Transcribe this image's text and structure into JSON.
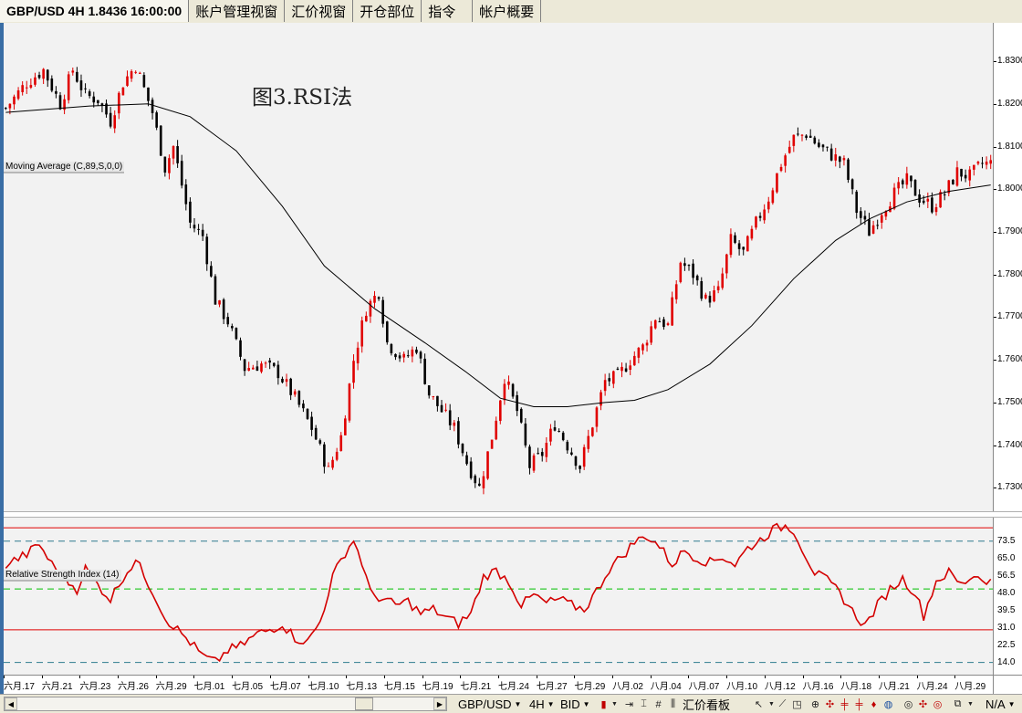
{
  "tabs": [
    {
      "label": "GBP/USD  4H  1.8436  16:00:00",
      "active": true
    },
    {
      "label": "账户管理视窗"
    },
    {
      "label": "汇价视窗"
    },
    {
      "label": "开仓部位"
    },
    {
      "label": "指令"
    },
    {
      "label": "帐户概要"
    }
  ],
  "annotation": "图3.RSI法",
  "indicators": {
    "moving_average": "Moving Average (C,89,S,0,0)",
    "rsi": "Relative Strength Index (14)"
  },
  "colors": {
    "bull": "#e00000",
    "bear": "#000000",
    "ma": "#000000",
    "rsi_line": "#d40000",
    "rsi_red_lines": "#e00000",
    "rsi_teal_lines": "#2e7b8e",
    "rsi_mid_line": "#00c000"
  },
  "chart_data": [
    {
      "type": "candlestick",
      "symbol": "GBP/USD",
      "timeframe": "4H",
      "last_price": "1.8436",
      "yticks": [
        "1.8300",
        "1.8200",
        "1.8100",
        "1.8000",
        "1.7900",
        "1.7800",
        "1.7700",
        "1.7600",
        "1.7500",
        "1.7400",
        "1.7300"
      ],
      "ylim": [
        1.7245,
        1.839
      ],
      "close_path": [
        [
          0,
          1.819
        ],
        [
          5,
          1.825
        ],
        [
          9,
          1.828
        ],
        [
          13,
          1.82
        ],
        [
          16,
          1.828
        ],
        [
          19,
          1.822
        ],
        [
          22,
          1.821
        ],
        [
          25,
          1.816
        ],
        [
          28,
          1.825
        ],
        [
          31,
          1.829
        ],
        [
          35,
          1.818
        ],
        [
          38,
          1.805
        ],
        [
          40,
          1.81
        ],
        [
          44,
          1.792
        ],
        [
          47,
          1.789
        ],
        [
          50,
          1.774
        ],
        [
          53,
          1.769
        ],
        [
          57,
          1.758
        ],
        [
          61,
          1.759
        ],
        [
          65,
          1.757
        ],
        [
          69,
          1.751
        ],
        [
          73,
          1.744
        ],
        [
          77,
          1.734
        ],
        [
          80,
          1.742
        ],
        [
          83,
          1.76
        ],
        [
          86,
          1.772
        ],
        [
          89,
          1.776
        ],
        [
          91,
          1.764
        ],
        [
          95,
          1.76
        ],
        [
          98,
          1.763
        ],
        [
          101,
          1.752
        ],
        [
          104,
          1.748
        ],
        [
          107,
          1.744
        ],
        [
          110,
          1.736
        ],
        [
          113,
          1.73
        ],
        [
          116,
          1.742
        ],
        [
          119,
          1.756
        ],
        [
          122,
          1.748
        ],
        [
          125,
          1.735
        ],
        [
          128,
          1.738
        ],
        [
          131,
          1.745
        ],
        [
          134,
          1.74
        ],
        [
          137,
          1.735
        ],
        [
          140,
          1.745
        ],
        [
          143,
          1.755
        ],
        [
          146,
          1.756
        ],
        [
          149,
          1.76
        ],
        [
          152,
          1.763
        ],
        [
          155,
          1.77
        ],
        [
          158,
          1.768
        ],
        [
          161,
          1.783
        ],
        [
          164,
          1.78
        ],
        [
          167,
          1.774
        ],
        [
          170,
          1.776
        ],
        [
          173,
          1.788
        ],
        [
          176,
          1.785
        ],
        [
          179,
          1.792
        ],
        [
          182,
          1.798
        ],
        [
          185,
          1.806
        ],
        [
          188,
          1.812
        ],
        [
          191,
          1.813
        ],
        [
          194,
          1.81
        ],
        [
          197,
          1.808
        ],
        [
          200,
          1.806
        ],
        [
          203,
          1.795
        ],
        [
          206,
          1.79
        ],
        [
          209,
          1.795
        ],
        [
          212,
          1.799
        ],
        [
          215,
          1.802
        ],
        [
          218,
          1.798
        ],
        [
          221,
          1.796
        ],
        [
          224,
          1.799
        ],
        [
          227,
          1.804
        ],
        [
          230,
          1.803
        ],
        [
          233,
          1.806
        ],
        [
          235,
          1.806
        ]
      ],
      "moving_average_path": [
        [
          0,
          1.818
        ],
        [
          20,
          1.8195
        ],
        [
          34,
          1.82
        ],
        [
          44,
          1.817
        ],
        [
          55,
          1.809
        ],
        [
          66,
          1.796
        ],
        [
          76,
          1.782
        ],
        [
          88,
          1.772
        ],
        [
          100,
          1.764
        ],
        [
          110,
          1.757
        ],
        [
          118,
          1.751
        ],
        [
          126,
          1.749
        ],
        [
          134,
          1.749
        ],
        [
          143,
          1.75
        ],
        [
          150,
          1.7505
        ],
        [
          158,
          1.753
        ],
        [
          168,
          1.759
        ],
        [
          178,
          1.768
        ],
        [
          188,
          1.779
        ],
        [
          198,
          1.788
        ],
        [
          206,
          1.793
        ],
        [
          215,
          1.797
        ],
        [
          225,
          1.7995
        ],
        [
          235,
          1.801
        ]
      ]
    },
    {
      "type": "line",
      "name": "Relative Strength Index (14)",
      "ylim": [
        8,
        85
      ],
      "yticks": [
        "73.5",
        "65.0",
        "56.5",
        "48.0",
        "39.5",
        "31.0",
        "22.5",
        "14.0"
      ],
      "levels_red": [
        30,
        80
      ],
      "levels_teal": [
        14,
        73.5
      ],
      "level_mid": 50,
      "path": [
        [
          0,
          62
        ],
        [
          5,
          67
        ],
        [
          8,
          72
        ],
        [
          11,
          62
        ],
        [
          14,
          55
        ],
        [
          17,
          50
        ],
        [
          19,
          60
        ],
        [
          22,
          52
        ],
        [
          25,
          45
        ],
        [
          28,
          56
        ],
        [
          31,
          64
        ],
        [
          33,
          57
        ],
        [
          36,
          45
        ],
        [
          38,
          36
        ],
        [
          41,
          30
        ],
        [
          44,
          24
        ],
        [
          47,
          17
        ],
        [
          50,
          14
        ],
        [
          53,
          20
        ],
        [
          56,
          22
        ],
        [
          60,
          28
        ],
        [
          63,
          30
        ],
        [
          66,
          33
        ],
        [
          69,
          26
        ],
        [
          72,
          24
        ],
        [
          75,
          34
        ],
        [
          78,
          56
        ],
        [
          81,
          68
        ],
        [
          83,
          74
        ],
        [
          85,
          63
        ],
        [
          87,
          48
        ],
        [
          90,
          45
        ],
        [
          93,
          42
        ],
        [
          96,
          44
        ],
        [
          99,
          38
        ],
        [
          102,
          40
        ],
        [
          105,
          36
        ],
        [
          108,
          33
        ],
        [
          111,
          38
        ],
        [
          114,
          56
        ],
        [
          117,
          59
        ],
        [
          120,
          54
        ],
        [
          123,
          42
        ],
        [
          126,
          47
        ],
        [
          129,
          43
        ],
        [
          132,
          45
        ],
        [
          135,
          42
        ],
        [
          138,
          40
        ],
        [
          141,
          49
        ],
        [
          144,
          60
        ],
        [
          147,
          66
        ],
        [
          150,
          73
        ],
        [
          153,
          76
        ],
        [
          156,
          71
        ],
        [
          159,
          62
        ],
        [
          162,
          69
        ],
        [
          165,
          65
        ],
        [
          168,
          63
        ],
        [
          171,
          66
        ],
        [
          174,
          62
        ],
        [
          177,
          70
        ],
        [
          180,
          74
        ],
        [
          183,
          79
        ],
        [
          186,
          81
        ],
        [
          188,
          79
        ],
        [
          190,
          70
        ],
        [
          193,
          58
        ],
        [
          196,
          54
        ],
        [
          199,
          48
        ],
        [
          202,
          39
        ],
        [
          205,
          32
        ],
        [
          208,
          42
        ],
        [
          211,
          50
        ],
        [
          214,
          55
        ],
        [
          217,
          48
        ],
        [
          219,
          37
        ],
        [
          222,
          54
        ],
        [
          225,
          58
        ],
        [
          228,
          52
        ],
        [
          231,
          57
        ],
        [
          233,
          55
        ],
        [
          235,
          54
        ]
      ]
    }
  ],
  "date_labels": [
    "六月.17",
    "六月.21",
    "六月.23",
    "六月.26",
    "六月.29",
    "七月.01",
    "七月.05",
    "七月.07",
    "七月.10",
    "七月.13",
    "七月.15",
    "七月.19",
    "七月.21",
    "七月.24",
    "七月.27",
    "七月.29",
    "八月.02",
    "八月.04",
    "八月.07",
    "八月.10",
    "八月.12",
    "八月.16",
    "八月.18",
    "八月.21",
    "八月.24",
    "八月.29"
  ],
  "toolbar": {
    "symbol": "GBP/USD",
    "timeframe": "4H",
    "side": "BID",
    "price_board": "汇价看板",
    "zoom": "N/A"
  }
}
